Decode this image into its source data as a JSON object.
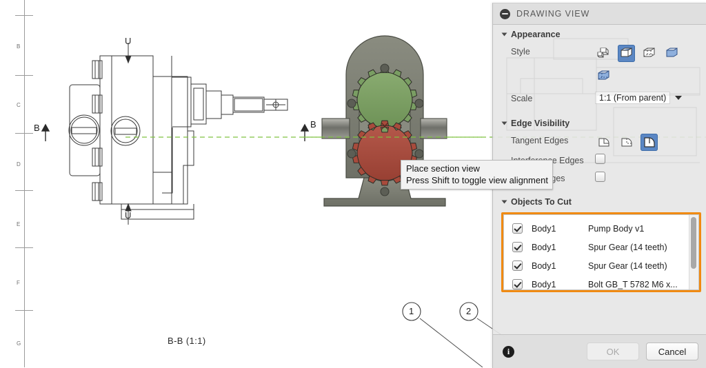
{
  "drawing": {
    "ruler_labels": [
      "B",
      "C",
      "D",
      "E",
      "F",
      "G"
    ],
    "front_view": {
      "top_marker": "U",
      "bottom_marker": "U",
      "section_left_label": "B",
      "section_right_label": "B"
    },
    "section_view": {
      "title": "B-B (1:1)",
      "gear_top_color": "#7a9e63",
      "gear_bottom_color": "#a84b3c",
      "body_color": "#7d7f75",
      "center_line_color": "#7fc241"
    },
    "balloons": [
      {
        "label": "1"
      },
      {
        "label": "2"
      }
    ]
  },
  "tooltip": {
    "line1": "Place section view",
    "line2": "Press Shift to toggle view alignment"
  },
  "panel": {
    "title": "DRAWING VIEW",
    "header_icon": "collapse-icon",
    "sections": {
      "appearance": {
        "title": "Appearance",
        "style": {
          "label": "Style",
          "options": [
            {
              "name": "style-wireframe",
              "selected": false
            },
            {
              "name": "style-visible-edges",
              "selected": true
            },
            {
              "name": "style-hidden-edges",
              "selected": false
            },
            {
              "name": "style-shaded",
              "selected": false
            },
            {
              "name": "style-shaded-hidden-edges",
              "selected": false
            }
          ]
        },
        "scale": {
          "label": "Scale",
          "value": "1:1 (From parent)",
          "icon": "chevron-down-icon"
        }
      },
      "edge_visibility": {
        "title": "Edge Visibility",
        "tangent_edges": {
          "label": "Tangent Edges",
          "options": [
            {
              "name": "tangent-edges-off",
              "selected": false
            },
            {
              "name": "tangent-edges-full",
              "selected": false
            },
            {
              "name": "tangent-edges-shortened",
              "selected": true
            }
          ]
        },
        "interference_edges": {
          "label": "Interference Edges",
          "checked": false
        },
        "thread_edges": {
          "label": "Thread Edges",
          "checked": false
        }
      },
      "objects_to_cut": {
        "title": "Objects To Cut",
        "highlight_color": "#f08a12",
        "rows": [
          {
            "checked": true,
            "body": "Body1",
            "description": "Pump Body v1"
          },
          {
            "checked": true,
            "body": "Body1",
            "description": "Spur Gear (14 teeth)"
          },
          {
            "checked": true,
            "body": "Body1",
            "description": "Spur Gear (14 teeth)"
          },
          {
            "checked": true,
            "body": "Body1",
            "description": "Bolt GB_T 5782 M6 x..."
          }
        ]
      }
    },
    "footer": {
      "info_icon": "info-icon",
      "info_glyph": "i",
      "ok_label": "OK",
      "ok_enabled": false,
      "cancel_label": "Cancel"
    }
  }
}
